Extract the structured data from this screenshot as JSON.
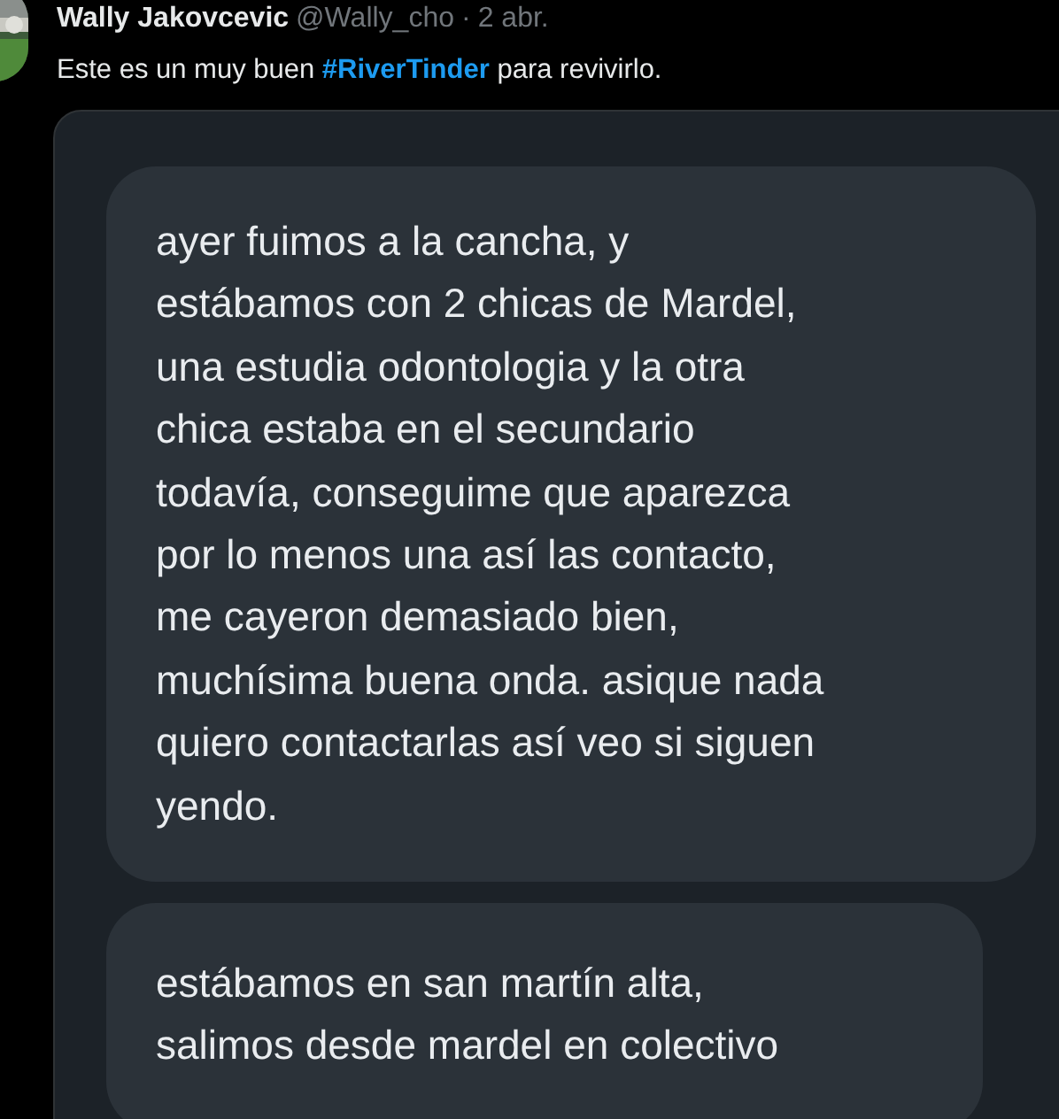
{
  "tweet": {
    "author": "Wally Jakovcevic",
    "handle": "@Wally_cho",
    "separator": "·",
    "date": "2 abr.",
    "text": "Este es un muy buen **#RiverTinder** para revivirlo."
  },
  "attachment": {
    "messages": [
      {
        "lines": [
          "ayer fuimos a la cancha, y",
          "estábamos con 2 chicas de Mardel,",
          "una estudia odontologia y la otra",
          "chica estaba en el secundario",
          "todavía, conseguime que aparezca",
          "por lo menos una así las contacto,",
          "me cayeron demasiado bien,",
          "muchísima buena onda. asique nada",
          "quiero contactarlas así veo si siguen",
          "yendo."
        ]
      },
      {
        "lines": [
          "estábamos en san martín alta,",
          "salimos desde mardel en colectivo"
        ]
      }
    ]
  }
}
